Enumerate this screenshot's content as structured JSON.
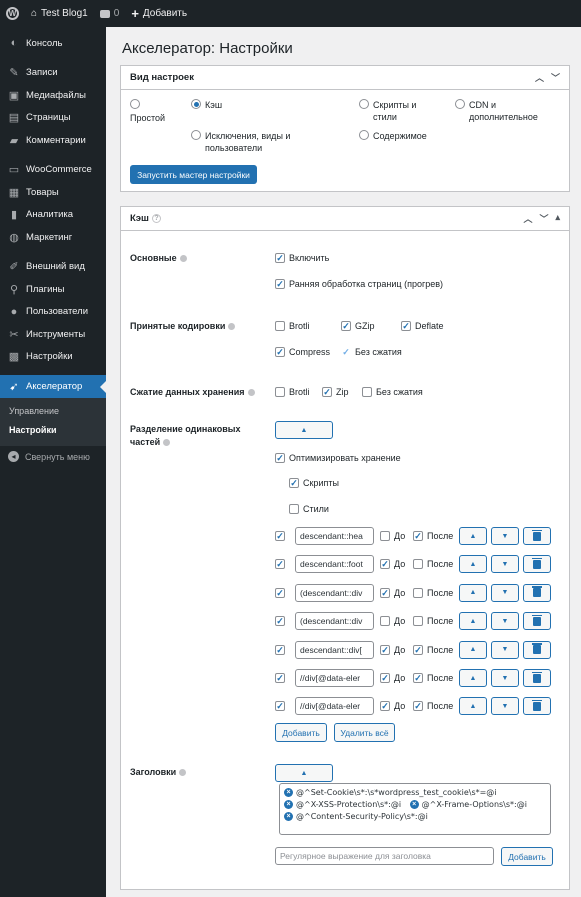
{
  "adminbar": {
    "site_name": "Test Blog1",
    "comments_count": "0",
    "new_label": "Добавить"
  },
  "sidebar": {
    "items": [
      {
        "label": "Консоль",
        "icon": "dashboard-icon"
      },
      {
        "label": "Записи",
        "icon": "pin-icon"
      },
      {
        "label": "Медиафайлы",
        "icon": "media-icon"
      },
      {
        "label": "Страницы",
        "icon": "pages-icon"
      },
      {
        "label": "Комментарии",
        "icon": "comments-icon"
      },
      {
        "label": "WooCommerce",
        "icon": "woocommerce-icon"
      },
      {
        "label": "Товары",
        "icon": "products-icon"
      },
      {
        "label": "Аналитика",
        "icon": "analytics-icon"
      },
      {
        "label": "Маркетинг",
        "icon": "marketing-icon"
      },
      {
        "label": "Внешний вид",
        "icon": "appearance-icon"
      },
      {
        "label": "Плагины",
        "icon": "plugins-icon"
      },
      {
        "label": "Пользователи",
        "icon": "users-icon"
      },
      {
        "label": "Инструменты",
        "icon": "tools-icon"
      },
      {
        "label": "Настройки",
        "icon": "settings-icon"
      },
      {
        "label": "Акселератор",
        "icon": "accelerator-icon"
      }
    ],
    "submenu": [
      "Управление",
      "Настройки"
    ],
    "collapse": "Свернуть меню"
  },
  "page": {
    "title": "Акселератор: Настройки"
  },
  "view_box": {
    "title": "Вид настроек",
    "options": {
      "simple": "Простой",
      "cache": "Кэш",
      "scripts": "Скрипты и стили",
      "cdn": "CDN и дополнительное",
      "exclusions": "Исключения, виды и пользователи",
      "content": "Содержимое"
    },
    "selected": "Кэш",
    "wizard_button": "Запустить мастер настройки"
  },
  "cache_box": {
    "title": "Кэш",
    "basic_label": "Основные",
    "enable": "Включить",
    "prewarm": "Ранняя обработка страниц (прогрев)",
    "encodings_label": "Принятые кодировки",
    "brotli": "Brotli",
    "gzip": "GZip",
    "deflate": "Deflate",
    "compress": "Compress",
    "no_compression": "Без сжатия",
    "storage_label": "Сжатие данных хранения",
    "zip": "Zip",
    "dedupe_label": "Разделение одинаковых частей",
    "optimize_storage": "Оптимизировать хранение",
    "scripts": "Скрипты",
    "styles": "Стили",
    "before": "До",
    "after": "После",
    "rows": [
      {
        "selector": "descendant::hea",
        "enabled": true,
        "before": false,
        "after": true
      },
      {
        "selector": "descendant::foot",
        "enabled": true,
        "before": true,
        "after": false
      },
      {
        "selector": "(descendant::div",
        "enabled": true,
        "before": true,
        "after": false
      },
      {
        "selector": "(descendant::div",
        "enabled": true,
        "before": false,
        "after": false
      },
      {
        "selector": "descendant::div[",
        "enabled": true,
        "before": true,
        "after": true
      },
      {
        "selector": "//div[@data-eler",
        "enabled": true,
        "before": true,
        "after": true
      },
      {
        "selector": "//div[@data-eler",
        "enabled": true,
        "before": true,
        "after": true
      }
    ],
    "add_button": "Добавить",
    "delete_all_button": "Удалить всё",
    "headers_label": "Заголовки",
    "headers": [
      "@^Set-Cookie\\s*:\\s*wordpress_test_cookie\\s*=@i",
      "@^X-XSS-Protection\\s*:@i",
      "@^X-Frame-Options\\s*:@i",
      "@^Content-Security-Policy\\s*:@i"
    ],
    "header_placeholder": "Регулярное выражение для заголовка",
    "header_add_button": "Добавить"
  }
}
